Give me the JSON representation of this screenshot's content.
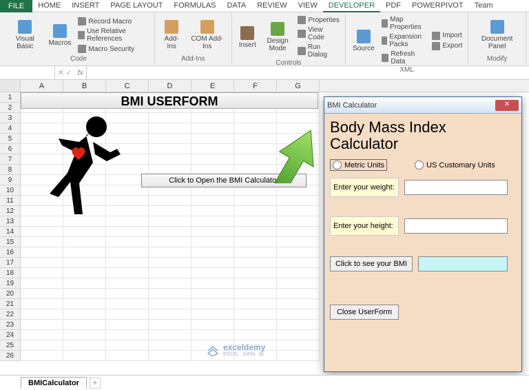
{
  "tabs": {
    "file": "FILE",
    "home": "HOME",
    "insert": "INSERT",
    "pagelayout": "PAGE LAYOUT",
    "formulas": "FORMULAS",
    "data": "DATA",
    "review": "REVIEW",
    "view": "VIEW",
    "developer": "DEVELOPER",
    "pdf": "PDF",
    "powerpivot": "POWERPIVOT",
    "team": "Team"
  },
  "ribbon": {
    "code": {
      "label": "Code",
      "vb": "Visual\nBasic",
      "macros": "Macros",
      "record": "Record Macro",
      "relref": "Use Relative References",
      "security": "Macro Security"
    },
    "addins": {
      "label": "Add-Ins",
      "addins": "Add-Ins",
      "com": "COM\nAdd-Ins"
    },
    "controls": {
      "label": "Controls",
      "insert": "Insert",
      "design": "Design\nMode",
      "props": "Properties",
      "viewcode": "View Code",
      "rundialog": "Run Dialog"
    },
    "xml": {
      "label": "XML",
      "source": "Source",
      "mapprops": "Map Properties",
      "expansion": "Expansion Packs",
      "refresh": "Refresh Data",
      "import": "Import",
      "export": "Export"
    },
    "modify": {
      "label": "Modify",
      "docpanel": "Document\nPanel"
    }
  },
  "formula_bar": {
    "fx": "fx"
  },
  "cols": [
    "A",
    "B",
    "C",
    "D",
    "E",
    "F",
    "G"
  ],
  "rows": [
    1,
    2,
    3,
    4,
    5,
    6,
    7,
    8,
    9,
    10,
    11,
    12,
    13,
    14,
    15,
    16,
    17,
    18,
    19,
    20,
    21,
    22,
    23,
    24,
    25,
    26
  ],
  "sheet": {
    "title": "BMI USERFORM",
    "open_btn": "Click to Open the BMI Calculator",
    "tab": "BMICalculator"
  },
  "userform": {
    "title": "BMI Calculator",
    "heading1": "Body Mass Index",
    "heading2": "Calculator",
    "metric": "Metric Units",
    "us": "US Customary Units",
    "weight": "Enter your weight:",
    "height": "Enter your height:",
    "calc": "Click to see your BMI",
    "close": "Close UserForm"
  },
  "watermark": {
    "brand": "exceldemy",
    "sub": "EXCEL · DATA · BI"
  }
}
